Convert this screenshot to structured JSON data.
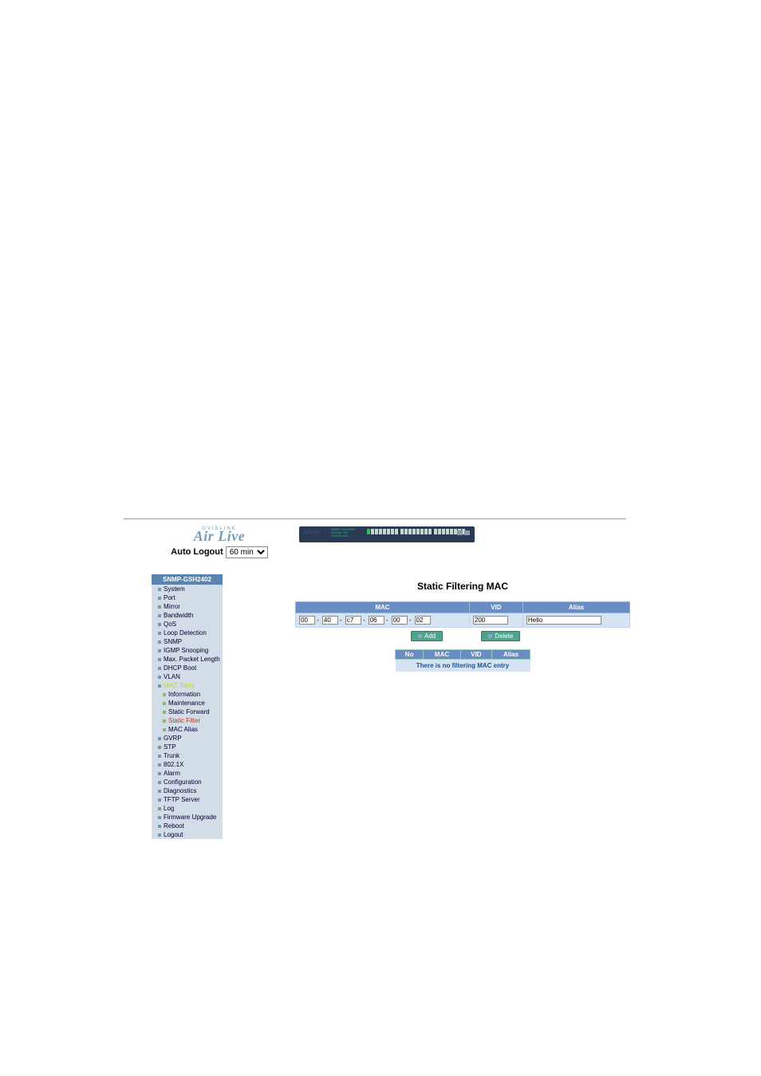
{
  "header": {
    "logo_over": "OVISLINK",
    "logo": "Air Live",
    "auto_logout_label": "Auto Logout",
    "auto_logout_value": "60 min"
  },
  "sidebar": {
    "header": "SNMP-GSH2402",
    "items": [
      "System",
      "Port",
      "Mirror",
      "Bandwidth",
      "QoS",
      "Loop Detection",
      "SNMP",
      "IGMP Snooping",
      "Max. Packet Length",
      "DHCP Boot",
      "VLAN",
      "MAC Table",
      "GVRP",
      "STP",
      "Trunk",
      "802.1X",
      "Alarm",
      "Configuration",
      "Diagnostics",
      "TFTP Server",
      "Log",
      "Firmware Upgrade",
      "Reboot",
      "Logout"
    ],
    "sub": [
      "Information",
      "Maintenance",
      "Static Forward",
      "Static Filter",
      "MAC Alias"
    ]
  },
  "main": {
    "title": "Static Filtering MAC",
    "columns": {
      "mac": "MAC",
      "vid": "VID",
      "alias": "Alias"
    },
    "form": {
      "mac": [
        "00",
        "40",
        "c7",
        "06",
        "00",
        "02"
      ],
      "vid": "200",
      "alias": "Hello"
    },
    "buttons": {
      "add": "Add",
      "delete": "Delete"
    },
    "list_columns": {
      "no": "No",
      "mac": "MAC",
      "vid": "VID",
      "alias": "Alias"
    },
    "empty_msg": "There is no filtering MAC entry"
  }
}
